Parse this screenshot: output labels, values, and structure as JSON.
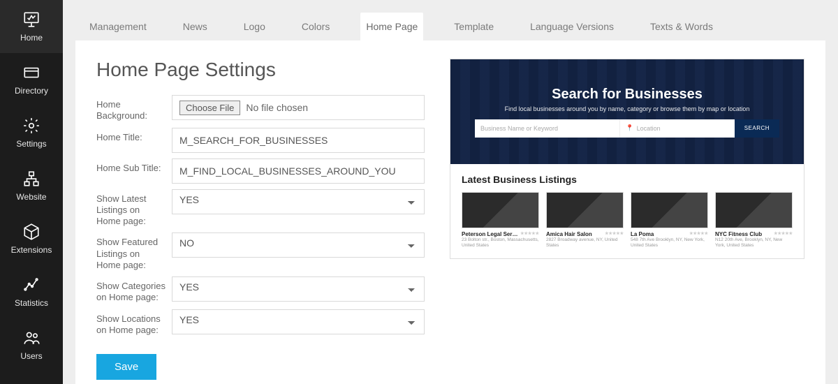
{
  "sidebar": [
    {
      "label": "Home",
      "icon": "home"
    },
    {
      "label": "Directory",
      "icon": "card"
    },
    {
      "label": "Settings",
      "icon": "gear"
    },
    {
      "label": "Website",
      "icon": "sitemap"
    },
    {
      "label": "Extensions",
      "icon": "cube"
    },
    {
      "label": "Statistics",
      "icon": "chart"
    },
    {
      "label": "Users",
      "icon": "users"
    }
  ],
  "tabs": [
    "Management",
    "News",
    "Logo",
    "Colors",
    "Home Page",
    "Template",
    "Language Versions",
    "Texts & Words"
  ],
  "active_tab": "Home Page",
  "page": {
    "title": "Home Page Settings",
    "file_button": "Choose File",
    "file_status": "No file chosen",
    "fields": {
      "home_bg_label": "Home Background:",
      "home_title_label": "Home Title:",
      "home_title_value": "M_SEARCH_FOR_BUSINESSES",
      "home_sub_label": "Home Sub Title:",
      "home_sub_value": "M_FIND_LOCAL_BUSINESSES_AROUND_YOU",
      "show_latest_label": "Show Latest Listings on Home page:",
      "show_latest_value": "YES",
      "show_featured_label": "Show Featured Listings on Home page:",
      "show_featured_value": "NO",
      "show_cats_label": "Show Categories on Home page:",
      "show_cats_value": "YES",
      "show_locs_label": "Show Locations on Home page:",
      "show_locs_value": "YES"
    },
    "save_label": "Save"
  },
  "preview": {
    "hero_title": "Search for Businesses",
    "hero_sub": "Find local businesses around you by name, category or browse them by map or location",
    "kw_placeholder": "Business Name or Keyword",
    "loc_placeholder": "Location",
    "search_btn": "SEARCH",
    "listings_heading": "Latest Business Listings",
    "cards": [
      {
        "title": "Peterson Legal Services",
        "addr": "23 Bolton str., Boston, Massachusetts, United States"
      },
      {
        "title": "Amica Hair Salon",
        "addr": "2827 Broadway avenue, NY, United States"
      },
      {
        "title": "La Poma",
        "addr": "548 7th Ave Brooklyn, NY, New York, United States"
      },
      {
        "title": "NYC Fitness Club",
        "addr": "N12 20th Ave, Brooklyn, NY, New York, United States"
      }
    ]
  }
}
